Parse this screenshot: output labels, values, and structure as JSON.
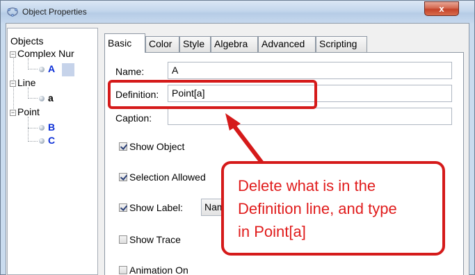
{
  "window": {
    "title": "Object Properties",
    "close_label": "x"
  },
  "tree": {
    "root_label": "Objects",
    "groups": [
      {
        "label": "Complex Nur",
        "items": [
          {
            "label": "A"
          }
        ]
      },
      {
        "label": "Line",
        "items": [
          {
            "label": "a"
          }
        ]
      },
      {
        "label": "Point",
        "items": [
          {
            "label": "B"
          },
          {
            "label": "C"
          }
        ]
      }
    ]
  },
  "tabs": [
    "Basic",
    "Color",
    "Style",
    "Algebra",
    "Advanced",
    "Scripting"
  ],
  "form": {
    "name_label": "Name:",
    "name_value": "A",
    "definition_label": "Definition:",
    "definition_value": "Point[a]",
    "caption_label": "Caption:",
    "caption_value": "",
    "show_object": "Show Object",
    "selection_allowed": "Selection Allowed",
    "show_label": "Show Label:",
    "label_mode": "Name",
    "show_trace": "Show Trace",
    "animation_on": "Animation On"
  },
  "checkboxes": {
    "show_object": true,
    "selection_allowed": true,
    "show_label": true,
    "show_trace": false,
    "animation_on": false
  },
  "annotation": {
    "text": "Delete what is in the\nDefinition line, and type\nin Point[a]",
    "color": "#d51a1a"
  }
}
